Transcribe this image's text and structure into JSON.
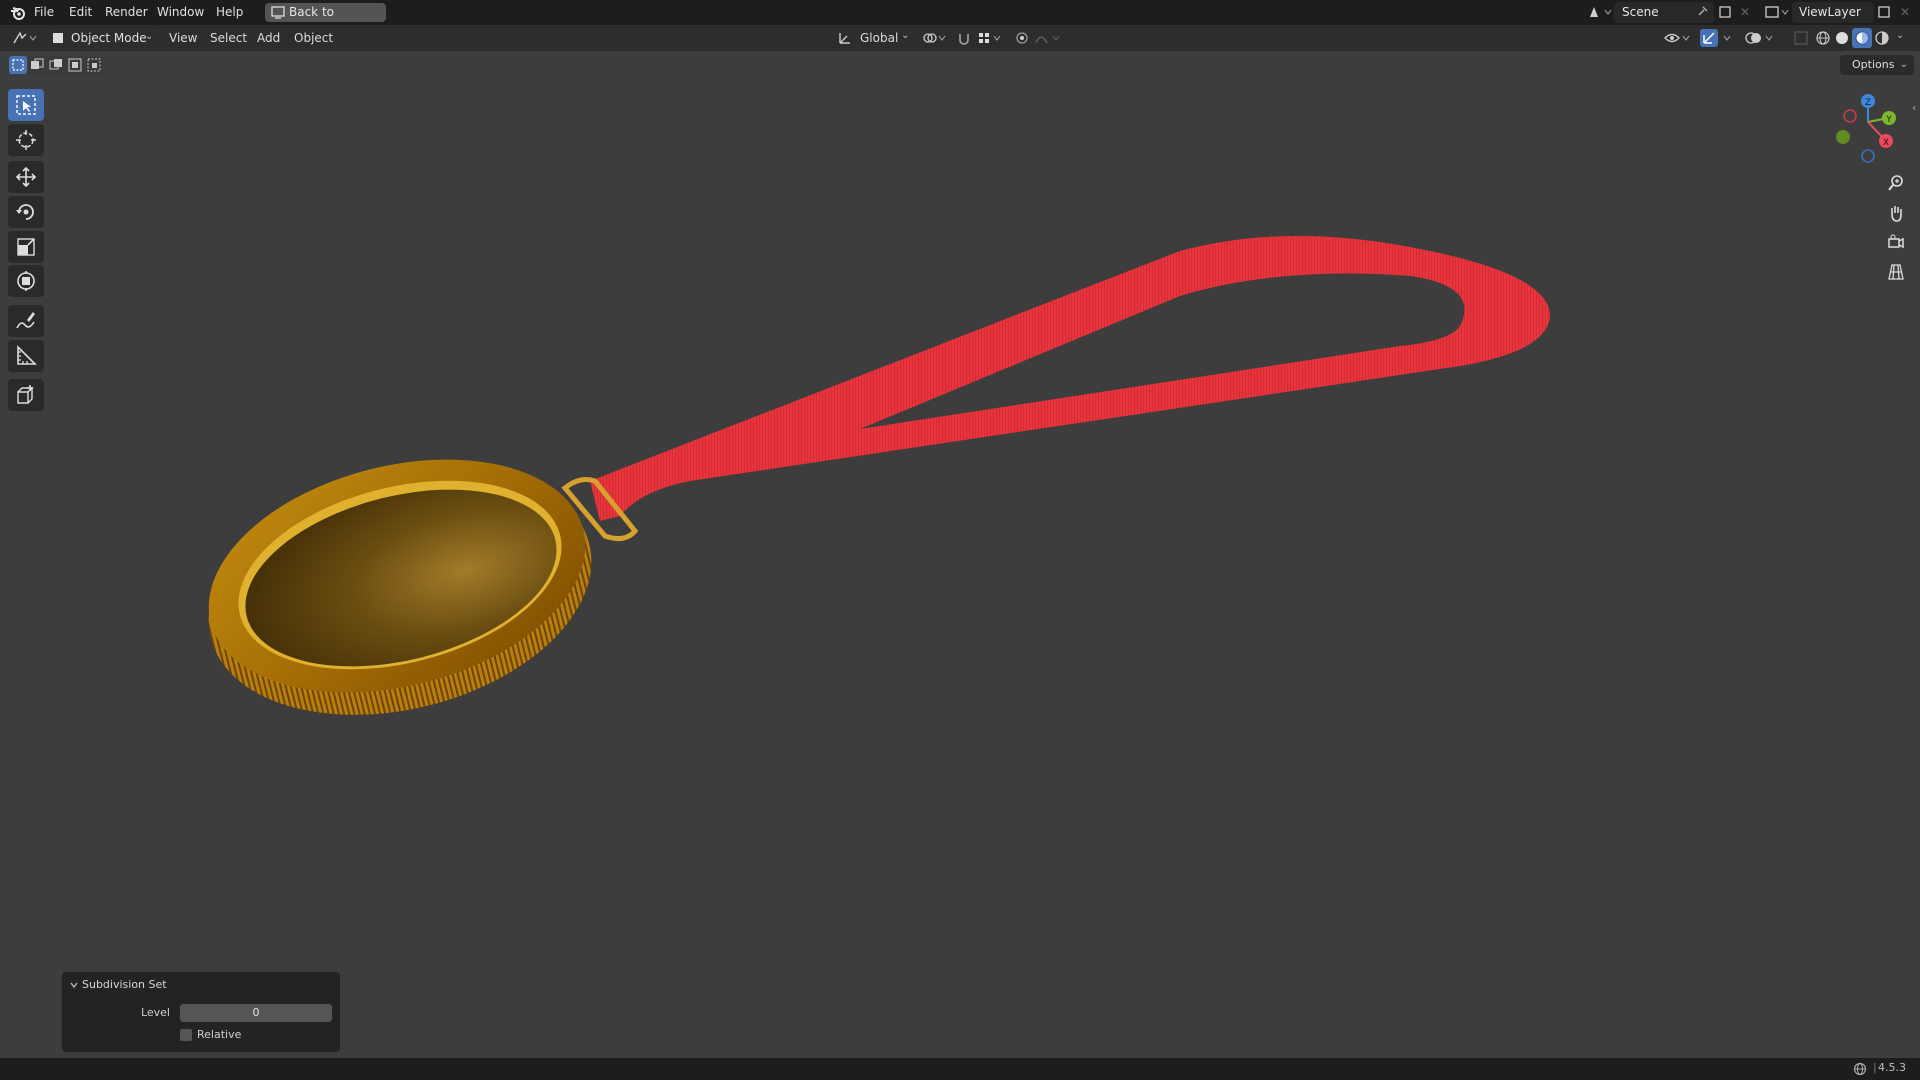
{
  "topbar": {
    "menus": [
      "File",
      "Edit",
      "Render",
      "Window",
      "Help"
    ],
    "back_button": "Back to Previous",
    "scene_name": "Scene",
    "view_layer": "ViewLayer"
  },
  "header": {
    "mode": "Object Mode",
    "menus": [
      "View",
      "Select",
      "Add",
      "Object"
    ],
    "orientation": "Global"
  },
  "viewport": {
    "options_label": "Options",
    "gizmo_axes": [
      "Z",
      "Y",
      "X"
    ]
  },
  "tools": [
    "select-box",
    "cursor",
    "move",
    "rotate",
    "scale",
    "transform",
    "annotate",
    "measure",
    "add-cube"
  ],
  "operator_panel": {
    "title": "Subdivision Set",
    "level_label": "Level",
    "level_value": "0",
    "relative_label": "Relative"
  },
  "statusbar": {
    "version": "4.5.3"
  },
  "colors": {
    "accent": "#4772b3",
    "ribbon": "#e8353d",
    "medal_gold": "#b8860b"
  }
}
